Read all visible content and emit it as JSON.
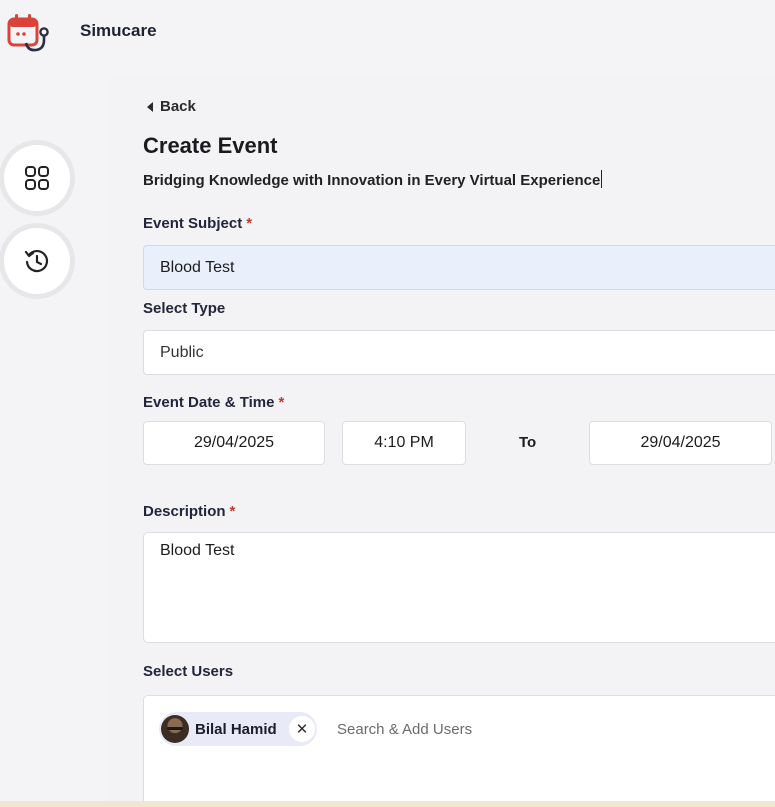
{
  "app": {
    "name": "Simucare"
  },
  "nav": {
    "back_label": "Back"
  },
  "page": {
    "title": "Create Event",
    "subtitle": "Bridging Knowledge with Innovation in Every Virtual Experience"
  },
  "form": {
    "subject": {
      "label": "Event Subject",
      "required": "*",
      "value": "Blood Test"
    },
    "type": {
      "label": "Select Type",
      "value": "Public"
    },
    "datetime": {
      "label": "Event Date & Time",
      "required": "*",
      "start_date": "29/04/2025",
      "start_time": "4:10 PM",
      "to_label": "To",
      "end_date": "29/04/2025"
    },
    "description": {
      "label": "Description",
      "required": "*",
      "value": "Blood Test"
    },
    "users": {
      "label": "Select Users",
      "selected": [
        {
          "name": "Bilal Hamid"
        }
      ],
      "remove_glyph": "✕",
      "search_placeholder": "Search & Add Users"
    }
  },
  "colors": {
    "accent_red": "#d9443a",
    "required": "#c0392b",
    "filled_bg": "#e9f0fc",
    "chip_bg": "#e8eaf7"
  },
  "icons": {
    "logo": "calendar-stethoscope-icon",
    "sidebar_1": "grid-icon",
    "sidebar_2": "history-clock-icon",
    "back": "caret-left-icon"
  }
}
